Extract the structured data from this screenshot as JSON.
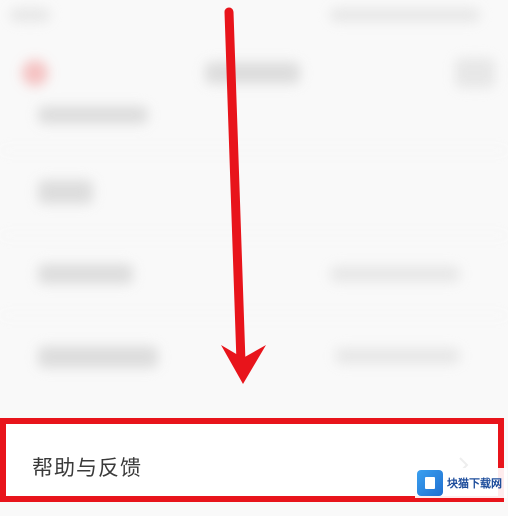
{
  "help_item": {
    "label": "帮助与反馈"
  },
  "watermark": {
    "title": "块猫下载网"
  },
  "colors": {
    "highlight_border": "#e8141b",
    "arrow": "#e8141b",
    "watermark_blue": "#1f6fd0"
  },
  "icons": {
    "arrow": "down-arrow-icon",
    "chevron": "chevron-right-icon",
    "logo": "watermark-logo-icon"
  }
}
